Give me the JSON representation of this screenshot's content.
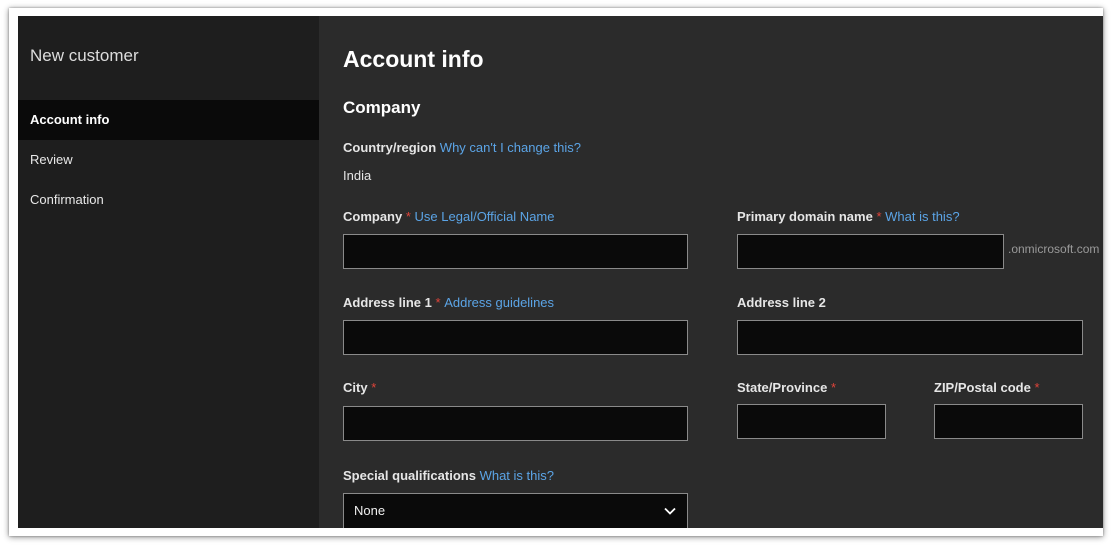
{
  "sidebar": {
    "title": "New customer",
    "items": [
      {
        "label": "Account info",
        "active": true
      },
      {
        "label": "Review",
        "active": false
      },
      {
        "label": "Confirmation",
        "active": false
      }
    ]
  },
  "main": {
    "heading": "Account info",
    "section": "Company",
    "country": {
      "label": "Country/region",
      "link": "Why can't I change this?",
      "value": "India"
    },
    "fields": {
      "company": {
        "label": "Company",
        "required": "*",
        "link": "Use Legal/Official Name",
        "value": ""
      },
      "primary_domain": {
        "label": "Primary domain name",
        "required": "*",
        "link": "What is this?",
        "value": "",
        "suffix": ".onmicrosoft.com"
      },
      "address1": {
        "label": "Address line 1",
        "required": "*",
        "link": "Address guidelines",
        "value": ""
      },
      "address2": {
        "label": "Address line 2",
        "value": ""
      },
      "city": {
        "label": "City",
        "required": "*",
        "value": ""
      },
      "state": {
        "label": "State/Province",
        "required": "*",
        "value": ""
      },
      "zip": {
        "label": "ZIP/Postal code",
        "required": "*",
        "value": ""
      },
      "special": {
        "label": "Special qualifications",
        "link": "What is this?",
        "selected": "None"
      }
    }
  },
  "colors": {
    "sidebar_bg": "#1e1e1e",
    "main_bg": "#2b2b2b",
    "input_bg": "#0a0a0a",
    "link": "#5ba4e6",
    "required": "#e0443a"
  }
}
